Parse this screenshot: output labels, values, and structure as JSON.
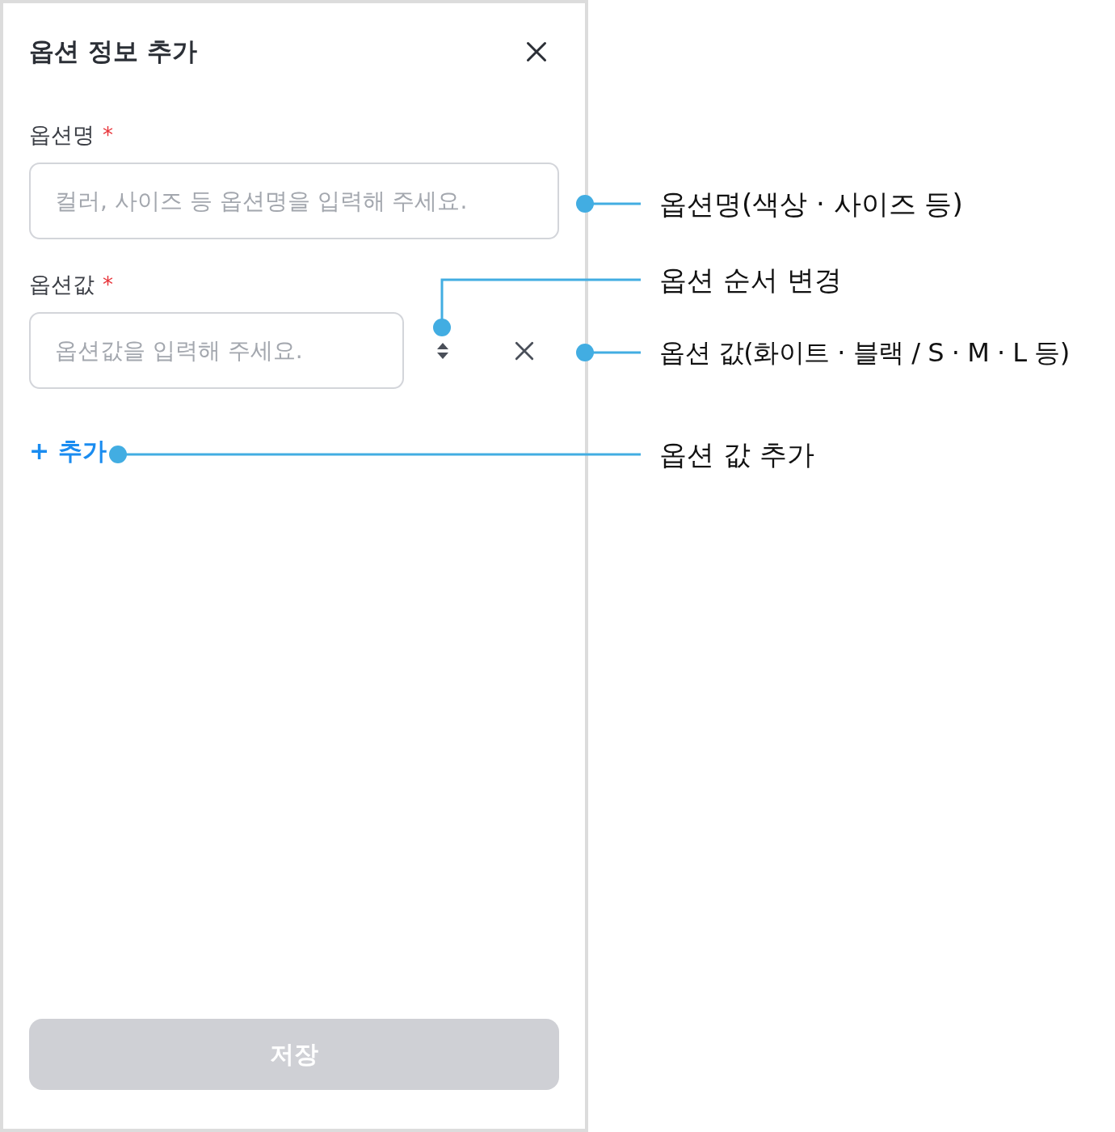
{
  "dialog": {
    "title": "옵션 정보 추가",
    "name_field": {
      "label": "옵션명",
      "required_mark": "*",
      "placeholder": "컬러, 사이즈 등 옵션명을 입력해 주세요."
    },
    "value_field": {
      "label": "옵션값",
      "required_mark": "*",
      "rows": [
        {
          "placeholder": "옵션값을 입력해 주세요."
        }
      ]
    },
    "add_link": "+ 추가",
    "save_button": {
      "label": "저장",
      "disabled": true
    }
  },
  "annotations": [
    {
      "label": "옵션명(색상 · 사이즈 등)",
      "kind": "straight"
    },
    {
      "label": "옵션 순서 변경",
      "kind": "elbow"
    },
    {
      "label": "옵션 값(화이트 · 블랙 / S · M · L 등)",
      "kind": "straight"
    },
    {
      "label": "옵션 값 추가",
      "kind": "straight"
    }
  ]
}
